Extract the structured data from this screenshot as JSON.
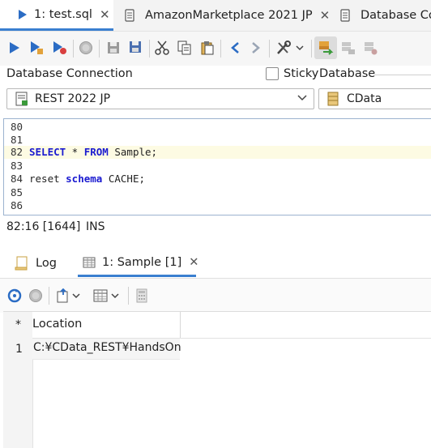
{
  "editor_tabs": [
    {
      "label": "1: test.sql",
      "active": true
    },
    {
      "label": "AmazonMarketplace 2021 JP",
      "active": false
    },
    {
      "label": "Database Con",
      "active": false
    }
  ],
  "connection": {
    "db_connection_label": "Database Connection",
    "sticky_label": "Sticky",
    "database_label": "Database",
    "connection_value": "REST 2022 JP",
    "database_value": "CData"
  },
  "editor": {
    "lines": [
      {
        "n": "80",
        "code": ""
      },
      {
        "n": "81",
        "code": ""
      },
      {
        "n": "82",
        "kw1": "SELECT",
        "mid": " * ",
        "kw2": "FROM",
        "rest": " Sample;"
      },
      {
        "n": "83",
        "code": ""
      },
      {
        "n": "84",
        "pre": "reset ",
        "kw1": "schema",
        "rest": " CACHE;"
      },
      {
        "n": "85",
        "code": ""
      },
      {
        "n": "86",
        "code": ""
      }
    ]
  },
  "status": {
    "position": "82:16 [1644]",
    "mode": "INS"
  },
  "bottom_tabs": [
    {
      "label": "Log"
    },
    {
      "label": "1: Sample [1]"
    }
  ],
  "results": {
    "columns": [
      "*",
      "Location"
    ],
    "rows": [
      {
        "num": "1",
        "location": "C:¥CData_REST¥HandsOn"
      }
    ]
  },
  "colors": {
    "accent": "#3a7fd0",
    "keyword": "#1a1ad0",
    "highlight_line": "#fdfbe3",
    "run_blue": "#2b6cc4"
  }
}
